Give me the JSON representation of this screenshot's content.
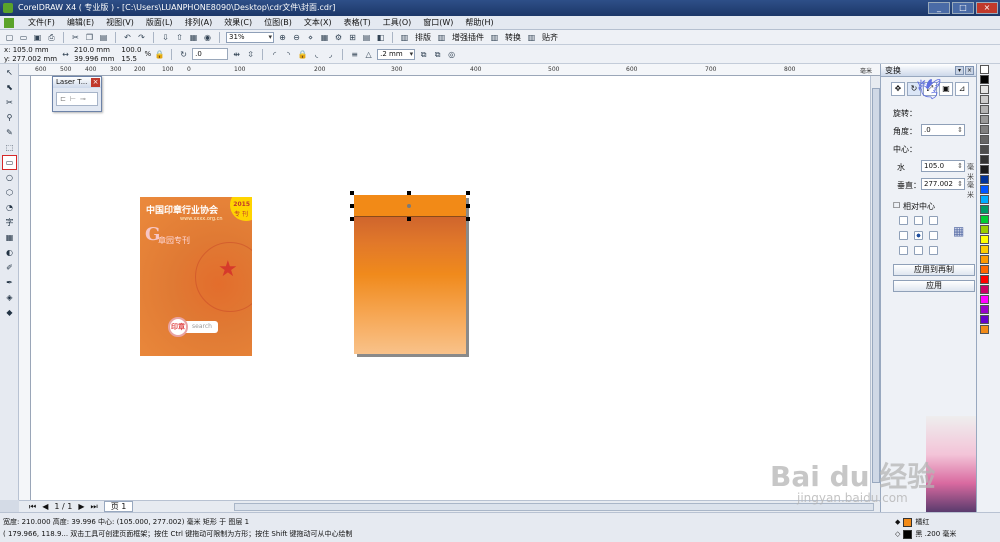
{
  "window": {
    "title": "CorelDRAW X4 ( 专业版 ) - [C:\\Users\\LUANPHONE8090\\Desktop\\cdr文件\\封面.cdr]",
    "buttons": [
      "_",
      "□",
      "×"
    ]
  },
  "menu": {
    "items": [
      "文件(F)",
      "编辑(E)",
      "视图(V)",
      "版面(L)",
      "排列(A)",
      "效果(C)",
      "位图(B)",
      "文本(X)",
      "表格(T)",
      "工具(O)",
      "窗口(W)",
      "帮助(H)"
    ]
  },
  "toolbar": {
    "zoom": "31%",
    "plugins": [
      "排版",
      "增强插件",
      "转换",
      "贴齐"
    ]
  },
  "property_bar": {
    "x": "x: 105.0 mm",
    "y": "y: 277.002 mm",
    "width": "210.0 mm",
    "height": "39.996 mm",
    "scale_x": "100.0",
    "scale_y": "15.5",
    "percent": "%",
    "rotation": ".0",
    "outline": ".2 mm"
  },
  "ruler": {
    "ticks": [
      "600",
      "500",
      "400",
      "300",
      "200",
      "100",
      "0",
      "100",
      "200",
      "300",
      "400",
      "500",
      "600",
      "700",
      "800"
    ],
    "unit": "毫米"
  },
  "laser_palette": {
    "title": "Laser T..."
  },
  "cover": {
    "title": "中国印章行业协会",
    "url": "www.xxxx.org.cn",
    "year": "2015",
    "issue": "专  刊",
    "logo": "G",
    "slogan": "章园专刊",
    "seal": "印章",
    "search": "search"
  },
  "bottom": {
    "page_count": "1 / 1",
    "page_tab": "页 1"
  },
  "status": {
    "line1": "宽度: 210.000  高度: 39.996  中心: (105.000, 277.002)  毫米        矩形 于 图层 1",
    "line2": "( 179.966, 118.9...    双击工具可创建页面框架；按住 Ctrl 键拖动可限制为方形；按住 Shift 键拖动可从中心绘制",
    "fill_name": "橘红",
    "outline_name": "黑  .200 毫米"
  },
  "docker": {
    "title": "变换",
    "rotate_label": "旋转：",
    "angle_label": "角度：",
    "angle_value": ".0",
    "center_label": "中心：",
    "h_label": "水",
    "h_value": "105.0",
    "v_label": "垂直：",
    "v_value": "277.002",
    "unit": "毫米",
    "relative_center": "相对中心",
    "apply_copy": "应用到再制",
    "apply": "应用"
  },
  "colors": {
    "accent": "#1c3768",
    "fill": "#f28a17",
    "palette": [
      "#ffffff",
      "#000000",
      "#e5e5e5",
      "#cccccc",
      "#b3b3b3",
      "#999999",
      "#808080",
      "#666666",
      "#4d4d4d",
      "#333333",
      "#1a1a1a",
      "#003399",
      "#0055ff",
      "#00aaff",
      "#009966",
      "#00cc33",
      "#99cc00",
      "#ffff00",
      "#ffcc00",
      "#ff9900",
      "#ff6600",
      "#ff0000",
      "#cc0066",
      "#ff00ff",
      "#9900cc",
      "#6600cc",
      "#f28a17"
    ]
  },
  "watermark": {
    "brand": "Bai du 经验",
    "url": "jingyan.baidu.com"
  }
}
